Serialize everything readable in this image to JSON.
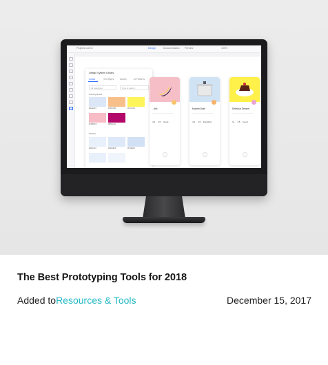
{
  "article": {
    "title": "The Best Prototyping Tools for 2018",
    "added_prefix": "Added to",
    "category_link": "Resources & Tools",
    "date": "December 15, 2017"
  },
  "screen": {
    "topbar": {
      "project": "Projects  Lorem",
      "tab_design": "Design",
      "tab_documentation": "Documentation",
      "tab_preview": "Preview",
      "zoom": "100%"
    },
    "panel": {
      "title": "Design System Library",
      "tabs": [
        "Colors",
        "Text Styles",
        "Assets",
        "UI Patterns"
      ],
      "select_placeholder": "All categories",
      "search_placeholder": "Type to search...",
      "section_primary": "Primary Brand",
      "section_shades": "Shades",
      "swatches": [
        {
          "label": "#E3E9F3",
          "color": "#dbe6f6"
        },
        {
          "label": "#F8C28B",
          "color": "#f7c08b"
        },
        {
          "label": "#FFF24A",
          "color": "#fff45a"
        },
        {
          "label": "#F6BBC5",
          "color": "#f8bcc6"
        },
        {
          "label": "#B50A6A",
          "color": "#b3086a"
        }
      ],
      "shades": [
        {
          "label": "#E8F0FC",
          "color": "#e8f0fc"
        },
        {
          "label": "#DDE8F8",
          "color": "#dde8f8"
        },
        {
          "label": "#D1E0F5",
          "color": "#d1e0f5"
        }
      ]
    },
    "cards": [
      {
        "name": "...lish",
        "stats": "4.0  4.5  Good",
        "image_color": "#f6bfc8",
        "badge_color": "#f7c56a"
      },
      {
        "name": "Modern Bush",
        "stats": "4.0  4.5  Excellent",
        "image_color": "#cfe3f5",
        "badge_color": "#f7b36a"
      },
      {
        "name": "Delicious Dessert",
        "stats": "3+  4.5  Good",
        "image_color": "#fff04a",
        "badge_color": "#e9a3d6"
      }
    ]
  }
}
